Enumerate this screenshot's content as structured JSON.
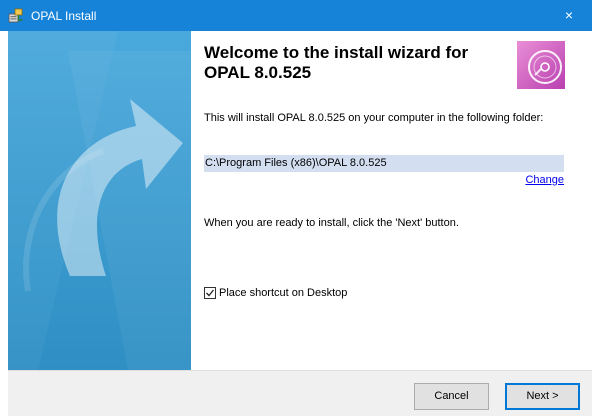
{
  "window": {
    "title": "OPAL Install",
    "close_glyph": "×",
    "title_icon": "installer-icon"
  },
  "banner": {
    "icon": "curved-arrow-graphic"
  },
  "content": {
    "heading": "Welcome to the install wizard for OPAL 8.0.525",
    "disc_icon": "disc-icon",
    "intro": "This will install OPAL 8.0.525 on your computer in the following folder:",
    "install_path": "C:\\Program Files (x86)\\OPAL 8.0.525",
    "change_label": "Change",
    "ready": "When you are ready to install, click the 'Next' button.",
    "shortcut_label": "Place shortcut on Desktop",
    "shortcut_checked": true
  },
  "buttons": {
    "cancel": "Cancel",
    "next": "Next >"
  },
  "colors": {
    "titlebar": "#1783d8",
    "banner": "#3b9fd1",
    "path_highlight": "#d3dff1",
    "link": "#0000ee",
    "footer": "#f0f0f0"
  }
}
